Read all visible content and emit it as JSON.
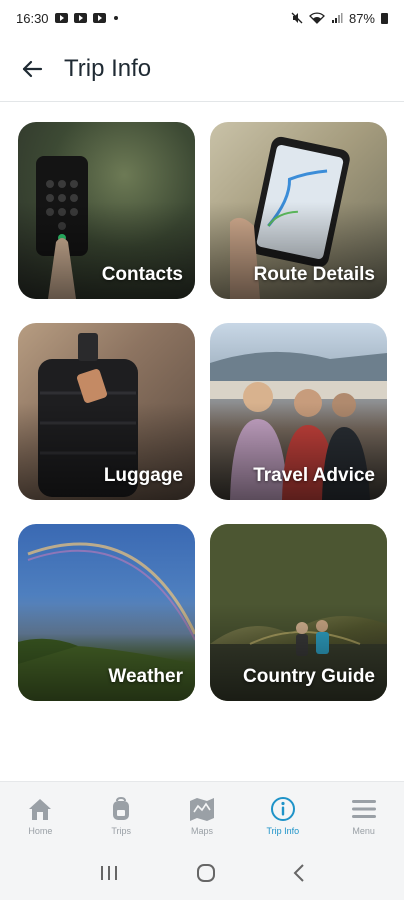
{
  "status_bar": {
    "time": "16:30",
    "battery": "87%"
  },
  "header": {
    "title": "Trip Info"
  },
  "cards": [
    {
      "label": "Contacts"
    },
    {
      "label": "Route Details"
    },
    {
      "label": "Luggage"
    },
    {
      "label": "Travel Advice"
    },
    {
      "label": "Weather"
    },
    {
      "label": "Country Guide"
    }
  ],
  "bottom_nav": {
    "items": [
      {
        "label": "Home",
        "icon": "home-icon"
      },
      {
        "label": "Trips",
        "icon": "backpack-icon"
      },
      {
        "label": "Maps",
        "icon": "map-icon"
      },
      {
        "label": "Trip Info",
        "icon": "info-icon"
      },
      {
        "label": "Menu",
        "icon": "menu-icon"
      }
    ],
    "active_color": "#1e93c8",
    "inactive_color": "#9aa0a6"
  }
}
